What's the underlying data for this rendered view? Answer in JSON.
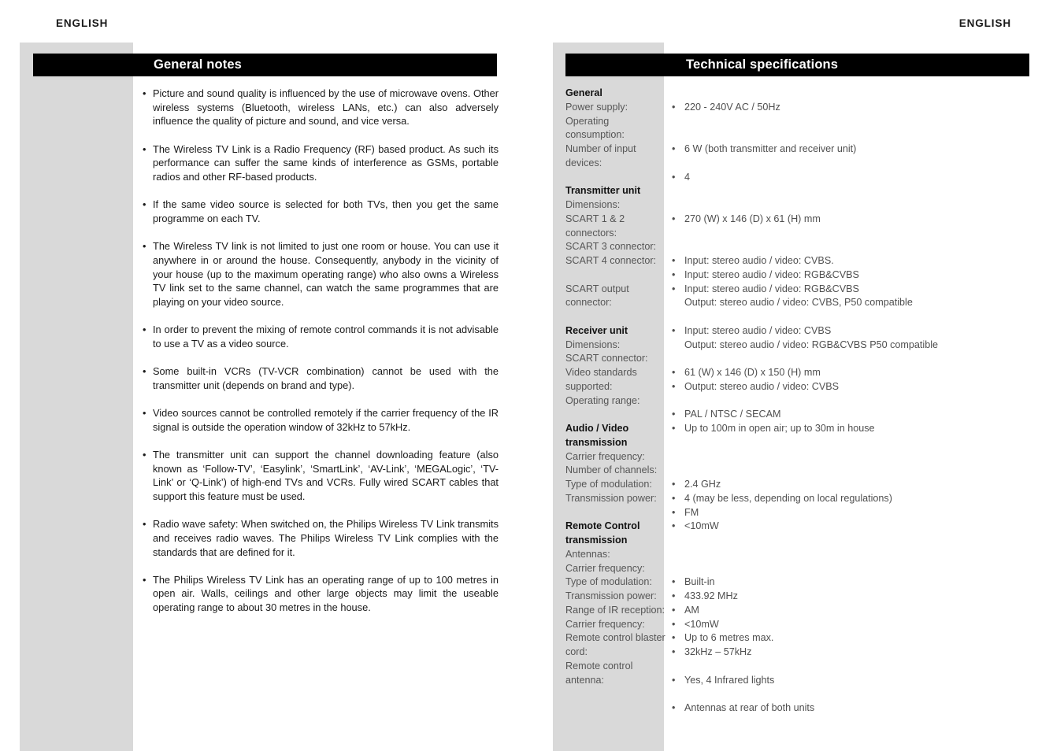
{
  "running_head": {
    "left": "ENGLISH",
    "right": "ENGLISH"
  },
  "left_column": {
    "title": "General notes",
    "bullet_glyph": "•",
    "notes": [
      "Picture and sound quality is influenced by the use of microwave ovens. Other wireless systems (Bluetooth, wireless LANs, etc.) can also adversely influence the quality of picture and sound, and vice versa.",
      "The Wireless TV Link is a Radio Frequency (RF) based product. As such its performance can suffer the same kinds of interference as GSMs, portable radios and other RF-based products.",
      "If the same video source is selected for both TVs, then you get the same programme on each TV.",
      "The Wireless TV link is not limited to just one room or house. You can use it anywhere in or around the house. Consequently, anybody in the vicinity of your house (up to the maximum operating range) who also owns a Wireless TV link set to the same channel, can watch the same programmes that are playing on your video source.",
      "In order to prevent the mixing of remote control commands it is not advisable to use a TV as a video source.",
      "Some built-in VCRs (TV-VCR combination) cannot be used with the transmitter unit (depends on brand and type).",
      "Video sources cannot be controlled remotely if the carrier frequency of the IR signal is outside the operation window of 32kHz to 57kHz.",
      "The transmitter unit can support the channel downloading feature (also known as ‘Follow-TV’, ‘Easylink’, ‘SmartLink’, ‘AV-Link’, ‘MEGALogic’, ‘TV-Link’ or ‘Q-Link’) of high-end TVs and VCRs. Fully wired SCART cables that support this feature must be used.",
      "Radio wave safety: When switched on, the Philips Wireless TV Link transmits and receives radio waves. The Philips Wireless TV Link complies with the standards that are defined for it.",
      "The Philips Wireless TV Link has an operating range of up to 100 metres in open air. Walls, ceilings and other large objects may limit the useable operating range to about 30 metres in the house."
    ]
  },
  "right_column": {
    "title": "Technical specifications",
    "bullet_glyph": "•",
    "label_lines": [
      {
        "text": "General",
        "heading": true
      },
      {
        "text": "Power supply:",
        "heading": false
      },
      {
        "text": "Operating",
        "heading": false
      },
      {
        "text": "consumption:",
        "heading": false
      },
      {
        "text": "Number of input",
        "heading": false
      },
      {
        "text": "devices:",
        "heading": false
      },
      {
        "text": "",
        "heading": false
      },
      {
        "text": "Transmitter unit",
        "heading": true
      },
      {
        "text": "Dimensions:",
        "heading": false
      },
      {
        "text": "SCART 1 & 2",
        "heading": false
      },
      {
        "text": "connectors:",
        "heading": false
      },
      {
        "text": "SCART 3 connector:",
        "heading": false
      },
      {
        "text": "SCART 4 connector:",
        "heading": false
      },
      {
        "text": "",
        "heading": false
      },
      {
        "text": "SCART output",
        "heading": false
      },
      {
        "text": "connector:",
        "heading": false
      },
      {
        "text": "",
        "heading": false
      },
      {
        "text": "Receiver unit",
        "heading": true
      },
      {
        "text": "Dimensions:",
        "heading": false
      },
      {
        "text": "SCART connector:",
        "heading": false
      },
      {
        "text": "Video standards",
        "heading": false
      },
      {
        "text": "supported:",
        "heading": false
      },
      {
        "text": "Operating range:",
        "heading": false
      },
      {
        "text": "",
        "heading": false
      },
      {
        "text": "Audio / Video",
        "heading": true
      },
      {
        "text": "transmission",
        "heading": true
      },
      {
        "text": "Carrier frequency:",
        "heading": false
      },
      {
        "text": "Number of channels:",
        "heading": false
      },
      {
        "text": "Type of modulation:",
        "heading": false
      },
      {
        "text": "Transmission power:",
        "heading": false
      },
      {
        "text": "",
        "heading": false
      },
      {
        "text": "Remote Control",
        "heading": true
      },
      {
        "text": "transmission",
        "heading": true
      },
      {
        "text": "Antennas:",
        "heading": false
      },
      {
        "text": "Carrier frequency:",
        "heading": false
      },
      {
        "text": "Type of modulation:",
        "heading": false
      },
      {
        "text": "Transmission power:",
        "heading": false
      },
      {
        "text": "Range of IR reception:",
        "heading": false
      },
      {
        "text": "Carrier frequency:",
        "heading": false
      },
      {
        "text": "Remote control blaster",
        "heading": false
      },
      {
        "text": "cord:",
        "heading": false
      },
      {
        "text": "Remote control",
        "heading": false
      },
      {
        "text": "antenna:",
        "heading": false
      }
    ],
    "value_lines": [
      {
        "text": "",
        "bullet": false
      },
      {
        "text": "220 - 240V AC / 50Hz",
        "bullet": true
      },
      {
        "text": "",
        "bullet": false
      },
      {
        "text": "",
        "bullet": false
      },
      {
        "text": "6 W (both transmitter and receiver unit)",
        "bullet": true
      },
      {
        "text": "",
        "bullet": false
      },
      {
        "text": "4",
        "bullet": true
      },
      {
        "text": "",
        "bullet": false
      },
      {
        "text": "",
        "bullet": false
      },
      {
        "text": "270 (W) x 146 (D) x 61 (H) mm",
        "bullet": true
      },
      {
        "text": "",
        "bullet": false
      },
      {
        "text": "",
        "bullet": false
      },
      {
        "text": "Input: stereo audio / video: CVBS.",
        "bullet": true
      },
      {
        "text": "Input: stereo audio / video: RGB&CVBS",
        "bullet": true
      },
      {
        "text": "Input: stereo audio / video: RGB&CVBS",
        "bullet": true
      },
      {
        "text": "Output: stereo audio / video: CVBS, P50 compatible",
        "bullet": false
      },
      {
        "text": "",
        "bullet": false
      },
      {
        "text": "Input: stereo audio / video: CVBS",
        "bullet": true
      },
      {
        "text": "Output: stereo audio / video: RGB&CVBS P50 compatible",
        "bullet": false
      },
      {
        "text": "",
        "bullet": false
      },
      {
        "text": "61 (W) x 146 (D) x 150 (H) mm",
        "bullet": true
      },
      {
        "text": "Output: stereo audio / video: CVBS",
        "bullet": true
      },
      {
        "text": "",
        "bullet": false
      },
      {
        "text": "PAL / NTSC / SECAM",
        "bullet": true
      },
      {
        "text": "Up to 100m in open air; up to 30m in house",
        "bullet": true
      },
      {
        "text": "",
        "bullet": false
      },
      {
        "text": "",
        "bullet": false
      },
      {
        "text": "",
        "bullet": false
      },
      {
        "text": "2.4 GHz",
        "bullet": true
      },
      {
        "text": "4 (may be less, depending on local regulations)",
        "bullet": true
      },
      {
        "text": "FM",
        "bullet": true
      },
      {
        "text": "<10mW",
        "bullet": true
      },
      {
        "text": "",
        "bullet": false
      },
      {
        "text": "",
        "bullet": false
      },
      {
        "text": "",
        "bullet": false
      },
      {
        "text": "Built-in",
        "bullet": true
      },
      {
        "text": "433.92 MHz",
        "bullet": true
      },
      {
        "text": "AM",
        "bullet": true
      },
      {
        "text": "<10mW",
        "bullet": true
      },
      {
        "text": "Up to 6 metres max.",
        "bullet": true
      },
      {
        "text": "32kHz – 57kHz",
        "bullet": true
      },
      {
        "text": "",
        "bullet": false
      },
      {
        "text": "Yes, 4 Infrared lights",
        "bullet": true
      },
      {
        "text": "",
        "bullet": false
      },
      {
        "text": "Antennas at rear of both units",
        "bullet": true
      }
    ]
  },
  "colors": {
    "band_gray": "#d9d9d9",
    "title_bar": "#000000",
    "title_text": "#ffffff",
    "body_text": "#1a1a1a",
    "label_text": "#565656",
    "value_text": "#4f4f4f"
  }
}
